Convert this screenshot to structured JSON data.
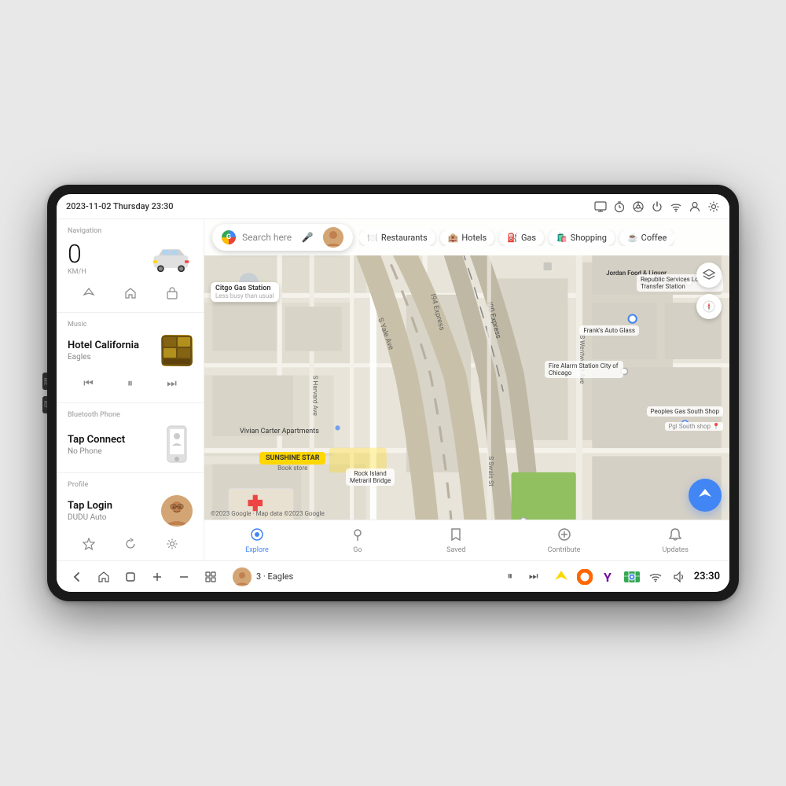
{
  "device": {
    "side_buttons": [
      "MIC",
      "RST"
    ]
  },
  "status_bar": {
    "datetime": "2023-11-02 Thursday 23:30",
    "icons": [
      "monitor-icon",
      "timer-icon",
      "steering-icon",
      "power-icon",
      "wifi-icon",
      "user-icon",
      "settings-icon"
    ]
  },
  "sidebar": {
    "navigation": {
      "label": "Navigation",
      "speed_value": "0",
      "speed_unit": "KM/H",
      "controls": [
        "direction-icon",
        "home-icon",
        "bag-icon"
      ]
    },
    "music": {
      "label": "Music",
      "title": "Hotel California",
      "artist": "Eagles",
      "controls": [
        "prev-icon",
        "pause-icon",
        "next-icon"
      ]
    },
    "bluetooth": {
      "label": "Bluetooth Phone",
      "title": "Tap Connect",
      "subtitle": "No Phone"
    },
    "profile": {
      "label": "Profile",
      "name": "Tap Login",
      "subtitle": "DUDU Auto",
      "controls": [
        "star-icon",
        "refresh-icon",
        "settings-icon"
      ]
    }
  },
  "map": {
    "search_placeholder": "Search here",
    "categories": [
      {
        "icon": "🍽️",
        "label": "Restaurants"
      },
      {
        "icon": "🏨",
        "label": "Hotels"
      },
      {
        "icon": "⛽",
        "label": "Gas"
      },
      {
        "icon": "🛍️",
        "label": "Shopping"
      },
      {
        "icon": "☕",
        "label": "Coffee"
      }
    ],
    "places": [
      "Citgo Gas Station",
      "Less busy than usual",
      "Jordan Food & Liquor",
      "Frank's Auto Glass",
      "Fire Alarm Station City of Chicago",
      "Republic Services Loop Transfer Station",
      "Peoples Gas South Shop",
      "Pgl South shop",
      "Vivian Carter Apartments",
      "SUNSHINE STAR Book store",
      "Rock Island Metraril Bridge"
    ],
    "bottom_nav": [
      {
        "icon": "🔍",
        "label": "Explore",
        "active": true
      },
      {
        "icon": "📍",
        "label": "Go",
        "active": false
      },
      {
        "icon": "🔖",
        "label": "Saved",
        "active": false
      },
      {
        "icon": "➕",
        "label": "Contribute",
        "active": false
      },
      {
        "icon": "🔔",
        "label": "Updates",
        "active": false
      }
    ],
    "copyright": "©2023 Google · Map data ©2023 Google"
  },
  "taskbar": {
    "back_label": "‹",
    "home_label": "⌂",
    "square_label": "☐",
    "add_label": "+",
    "dash_label": "−",
    "grid_label": "⊞",
    "track_num": "3",
    "track_name": "Eagles",
    "play_pause": "⏸",
    "next": "⏭",
    "status_icons": {
      "location": "🧭",
      "donut": "🍩",
      "yahoo": "Y",
      "maps": "🗺",
      "wifi": "wifi",
      "volume": "volume"
    },
    "time": "23:30"
  }
}
